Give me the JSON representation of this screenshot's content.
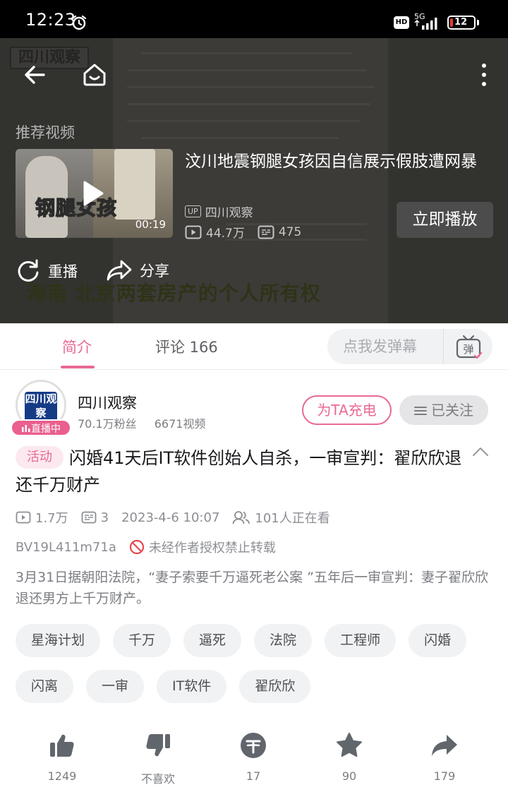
{
  "status_bar": {
    "time": "12:23",
    "network": "5G",
    "battery": "12",
    "battery_fraction": 0.12
  },
  "player": {
    "watermark": "四川观察",
    "caption": "海南 北京两套房产的个人所有权",
    "recommend_title": "推荐视频",
    "recommended": {
      "thumb_label": "钢腿女孩",
      "duration": "00:19",
      "title": "汶川地震钢腿女孩因自信展示假肢遭网暴",
      "up_badge": "UP",
      "uploader": "四川观察",
      "views": "44.7万",
      "danmaku": "475",
      "play_now": "立即播放"
    },
    "replay_label": "重播",
    "share_label": "分享"
  },
  "tabs": {
    "intro": "简介",
    "comments": "评论 166",
    "danmaku_placeholder": "点我发弹幕",
    "danmaku_glyph": "弹"
  },
  "channel": {
    "avatar_text": "四川观察",
    "live_label": "直播中",
    "name": "四川观察",
    "fans": "70.1万粉丝",
    "videos": "6671视频",
    "charge_label": "为TA充电",
    "follow_label": "已关注"
  },
  "video": {
    "tag": "活动",
    "title": "闪婚41天后IT软件创始人自杀，一审宣判：翟欣欣退还千万财产",
    "views": "1.7万",
    "danmaku": "3",
    "date": "2023-4-6 10:07",
    "watching": "101人正在看",
    "bvid": "BV19L411m71a",
    "no_repost": "未经作者授权禁止转载",
    "description": "3月31日据朝阳法院，“妻子索要千万逼死老公案 ”五年后一审宣判：妻子翟欣欣退还男方上千万财产。",
    "tags": [
      "星海计划",
      "千万",
      "逼死",
      "法院",
      "工程师",
      "闪婚",
      "闪离",
      "一审",
      "IT软件",
      "翟欣欣"
    ]
  },
  "actions": {
    "like": "1249",
    "dislike": "不喜欢",
    "coin": "17",
    "favorite": "90",
    "share": "179"
  },
  "colors": {
    "accent": "#e86a92",
    "live": "#ea5f8e",
    "icon": "#61666d"
  }
}
